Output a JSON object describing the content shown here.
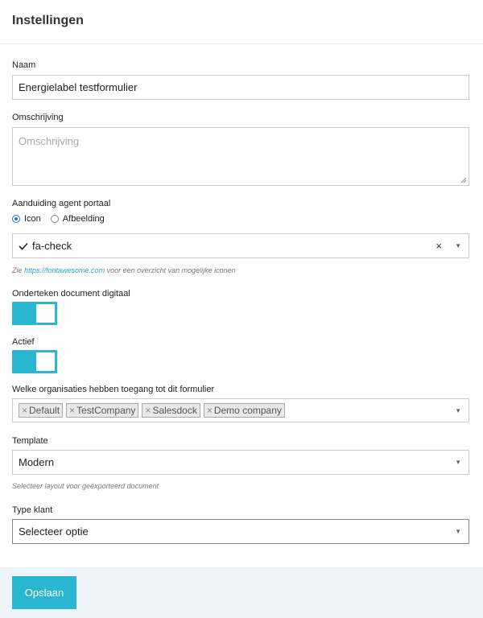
{
  "header": {
    "title": "Instellingen"
  },
  "name": {
    "label": "Naam",
    "value": "Energielabel testformulier"
  },
  "description": {
    "label": "Omschrijving",
    "placeholder": "Omschrijving"
  },
  "agent_portal": {
    "label": "Aanduiding agent portaal",
    "options": [
      {
        "label": "Icon",
        "checked": true
      },
      {
        "label": "Afbeelding",
        "checked": false
      }
    ],
    "icon_value": "fa-check",
    "clear": "×",
    "arrow": "▼",
    "help_prefix": "Zie ",
    "help_link": "https://fontawesome.com",
    "help_suffix": " voor een overzicht van mogelijke iconen"
  },
  "sign_digital": {
    "label": "Onderteken document digitaal",
    "on": true
  },
  "active": {
    "label": "Actief",
    "on": true
  },
  "organisations": {
    "label": "Welke organisaties hebben toegang tot dit formulier",
    "tags": [
      "Default",
      "TestCompany",
      "Salesdock",
      "Demo company"
    ],
    "tag_remove": "×",
    "arrow": "▼"
  },
  "template": {
    "label": "Template",
    "value": "Modern",
    "arrow": "▼",
    "help": "Selecteer layout voor geëxporteerd document"
  },
  "customer_type": {
    "label": "Type klant",
    "value": "Selecteer optie",
    "arrow": "▼"
  },
  "footer": {
    "save_label": "Opslaan"
  },
  "colors": {
    "accent": "#29b6d0",
    "link": "#2aa8c9"
  },
  "icons": {
    "check": "check-icon",
    "resize": "resize-grip-icon"
  }
}
